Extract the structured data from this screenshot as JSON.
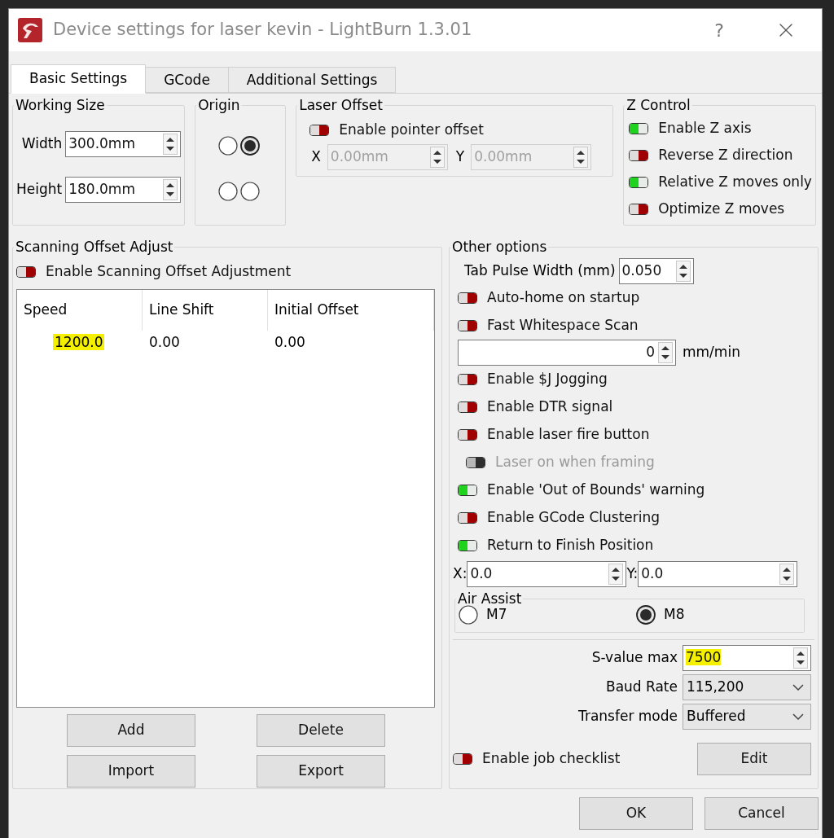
{
  "window": {
    "title": "Device settings for laser kevin - LightBurn 1.3.01",
    "help": "?"
  },
  "tabs": [
    {
      "label": "Basic Settings",
      "selected": true
    },
    {
      "label": "GCode",
      "selected": false
    },
    {
      "label": "Additional Settings",
      "selected": false
    }
  ],
  "working_size": {
    "title": "Working Size",
    "fields": [
      {
        "label": "Width",
        "value": "300.0mm"
      },
      {
        "label": "Height",
        "value": "180.0mm"
      }
    ]
  },
  "origin": {
    "title": "Origin",
    "corners": [
      {
        "selected": false
      },
      {
        "selected": true
      },
      {
        "selected": false
      },
      {
        "selected": false
      }
    ]
  },
  "laser_offset": {
    "title": "Laser Offset",
    "toggle": {
      "label": "Enable pointer offset",
      "on": false,
      "disabled": false
    },
    "fields": [
      {
        "label": "X",
        "value": "0.00mm",
        "disabled": true
      },
      {
        "label": "Y",
        "value": "0.00mm",
        "disabled": true
      }
    ]
  },
  "z_control": {
    "title": "Z Control",
    "toggles": [
      {
        "label": "Enable Z axis",
        "on": true,
        "disabled": false
      },
      {
        "label": "Reverse Z direction",
        "on": false,
        "disabled": false
      },
      {
        "label": "Relative Z moves only",
        "on": true,
        "disabled": false
      },
      {
        "label": "Optimize Z moves",
        "on": false,
        "disabled": false
      }
    ]
  },
  "scanning": {
    "title": "Scanning Offset Adjust",
    "toggle": {
      "label": "Enable Scanning Offset Adjustment",
      "on": false,
      "disabled": false
    },
    "table": {
      "columns": [
        "Speed",
        "Line Shift",
        "Initial Offset"
      ],
      "rows": [
        {
          "cells": [
            {
              "text": "1200.0",
              "highlighted": true
            },
            {
              "text": "0.00",
              "highlighted": false
            },
            {
              "text": "0.00",
              "highlighted": false
            }
          ]
        }
      ]
    },
    "buttons": [
      "Add",
      "Delete",
      "Import",
      "Export"
    ]
  },
  "other_options": {
    "title": "Other options",
    "tab_pulse": {
      "label": "Tab Pulse Width (mm)",
      "value": "0.050"
    },
    "toggles_a": [
      {
        "label": "Auto-home on startup",
        "on": false,
        "disabled": false
      },
      {
        "label": "Fast Whitespace Scan",
        "on": false,
        "disabled": false
      }
    ],
    "whitespace_speed": {
      "value": "0",
      "unit": "mm/min"
    },
    "toggles_b": [
      {
        "label": "Enable $J Jogging",
        "on": false,
        "disabled": false
      },
      {
        "label": "Enable DTR signal",
        "on": false,
        "disabled": false
      },
      {
        "label": "Enable laser fire button",
        "on": false,
        "disabled": false
      },
      {
        "label": "Laser on when framing",
        "on": false,
        "disabled": true
      },
      {
        "label": "Enable 'Out of Bounds' warning",
        "on": true,
        "disabled": false
      },
      {
        "label": "Enable GCode Clustering",
        "on": false,
        "disabled": false
      },
      {
        "label": "Return to Finish Position",
        "on": true,
        "disabled": false
      }
    ],
    "finish_position": [
      {
        "label": "X:",
        "value": "0.0"
      },
      {
        "label": "Y:",
        "value": "0.0"
      }
    ],
    "air_assist": {
      "title": "Air Assist",
      "options": [
        {
          "label": "M7",
          "selected": false
        },
        {
          "label": "M8",
          "selected": true
        }
      ]
    },
    "form": [
      {
        "kind": "spin",
        "label": "S-value max",
        "value": "7500",
        "highlighted": true
      },
      {
        "kind": "select",
        "label": "Baud Rate",
        "value": "115,200"
      },
      {
        "kind": "select",
        "label": "Transfer mode",
        "value": "Buffered"
      }
    ],
    "job_checklist": {
      "label": "Enable job checklist",
      "on": false,
      "disabled": false
    },
    "edit_button": "Edit"
  },
  "footer_buttons": [
    "OK",
    "Cancel"
  ]
}
